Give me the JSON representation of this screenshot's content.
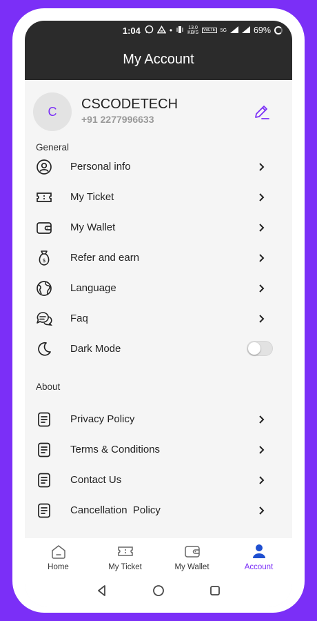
{
  "status_bar": {
    "time": "1:04",
    "data_speed": "13.0",
    "data_unit": "KB/S",
    "volte": "VoLTE",
    "network": "5G",
    "battery": "69%"
  },
  "header": {
    "title": "My Account"
  },
  "profile": {
    "avatar_initial": "C",
    "name": "CSCODETECH",
    "phone": "+91 2277996633"
  },
  "sections": {
    "general": "General",
    "about": "About"
  },
  "general_items": [
    {
      "label": "Personal info",
      "icon": "user-circle-icon"
    },
    {
      "label": "My Ticket",
      "icon": "ticket-icon"
    },
    {
      "label": "My Wallet",
      "icon": "wallet-icon"
    },
    {
      "label": "Refer and earn",
      "icon": "money-bag-icon"
    },
    {
      "label": "Language",
      "icon": "globe-icon"
    },
    {
      "label": "Faq",
      "icon": "chat-bubbles-icon"
    },
    {
      "label": "Dark Mode",
      "icon": "moon-icon",
      "toggle_on": false
    }
  ],
  "about_items": [
    {
      "label": "Privacy Policy",
      "icon": "document-icon"
    },
    {
      "label": "Terms & Conditions",
      "icon": "document-icon"
    },
    {
      "label": "Contact Us",
      "icon": "document-icon"
    },
    {
      "label": "Cancellation  Policy",
      "icon": "document-icon"
    }
  ],
  "bottom_nav": [
    {
      "label": "Home",
      "icon": "home-icon",
      "active": false
    },
    {
      "label": "My Ticket",
      "icon": "ticket-icon",
      "active": false
    },
    {
      "label": "My Wallet",
      "icon": "wallet-icon",
      "active": false
    },
    {
      "label": "Account",
      "icon": "person-icon",
      "active": true
    }
  ],
  "colors": {
    "accent": "#7b2ff7",
    "header_bg": "#2b2b2b",
    "screen_bg": "#f5f5f5"
  }
}
